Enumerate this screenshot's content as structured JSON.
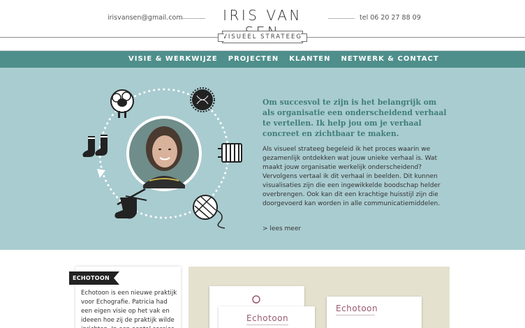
{
  "header": {
    "email": "irisvansen@gmail.com",
    "brand": "IRIS VAN SEN",
    "tagline": "VISUEEL STRATEEG",
    "phone": "tel 06 20 27 88 09"
  },
  "nav": {
    "items": [
      {
        "label": "VISIE & WERKWIJZE"
      },
      {
        "label": "PROJECTEN"
      },
      {
        "label": "KLANTEN"
      },
      {
        "label": "NETWERK & CONTACT"
      }
    ]
  },
  "hero": {
    "lead": "Om succesvol te zijn is het belangrijk om als organisatie een onderscheidend verhaal te vertellen. Ik help jou om je verhaal concreet en zichtbaar te maken.",
    "body": "Als visueel strateeg begeleid ik het proces waarin we gezamenlijk ontdekken wat jouw unieke verhaal is. Wat maakt jouw organisatie werkelijk onderscheidend? Vervolgens vertaal ik dit verhaal in beelden. Dit kunnen visualisaties zijn die een ingewikkelde boodschap helder overbrengen. Ook kan dit een krachtige huisstijl zijn die doorgevoerd kan worden in alle communicatiemiddelen.",
    "more": "> lees meer",
    "icons": [
      "sheep-icon",
      "wool-tangle-icon",
      "yarn-skein-icon",
      "yarn-ball-icon",
      "knitting-sock-icon",
      "socks-icon"
    ]
  },
  "project": {
    "ribbon": "ECHOTOON",
    "text": "Echotoon is een nieuwe praktijk voor Echografie. Patricia had een eigen visie op het vak en ideeen hoe zij de praktijk wilde inrichten. In een aantal sessies heb ik haar",
    "logo": "Echotoon"
  },
  "colors": {
    "nav": "#4f8f8b",
    "hero": "#a9ccd0",
    "lead": "#3e7e78",
    "panel": "#e4e1cf",
    "logo": "#9a5a6e"
  }
}
